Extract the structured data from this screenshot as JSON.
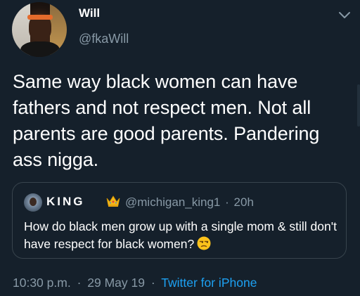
{
  "tweet": {
    "display_name": "Will",
    "handle": "@fkaWill",
    "text": "Same way black women can have fathers and not respect men. Not all parents are good parents. Pandering ass nigga.",
    "time": "10:30 p.m.",
    "date": "29 May 19",
    "source": "Twitter for iPhone",
    "separator": "·"
  },
  "quoted_tweet": {
    "display_name": "KING",
    "badge_icon": "crown-emoji-icon",
    "handle": "@michigan_king1",
    "separator": "·",
    "age": "20h",
    "text": "How do black men grow up with a single mom & still don't have respect for black women?",
    "emoji_icon": "unamused-face-emoji-icon"
  },
  "colors": {
    "background": "#15202b",
    "text": "#ffffff",
    "secondary_text": "#8899a6",
    "link": "#1da1f2",
    "border": "#38444d"
  }
}
